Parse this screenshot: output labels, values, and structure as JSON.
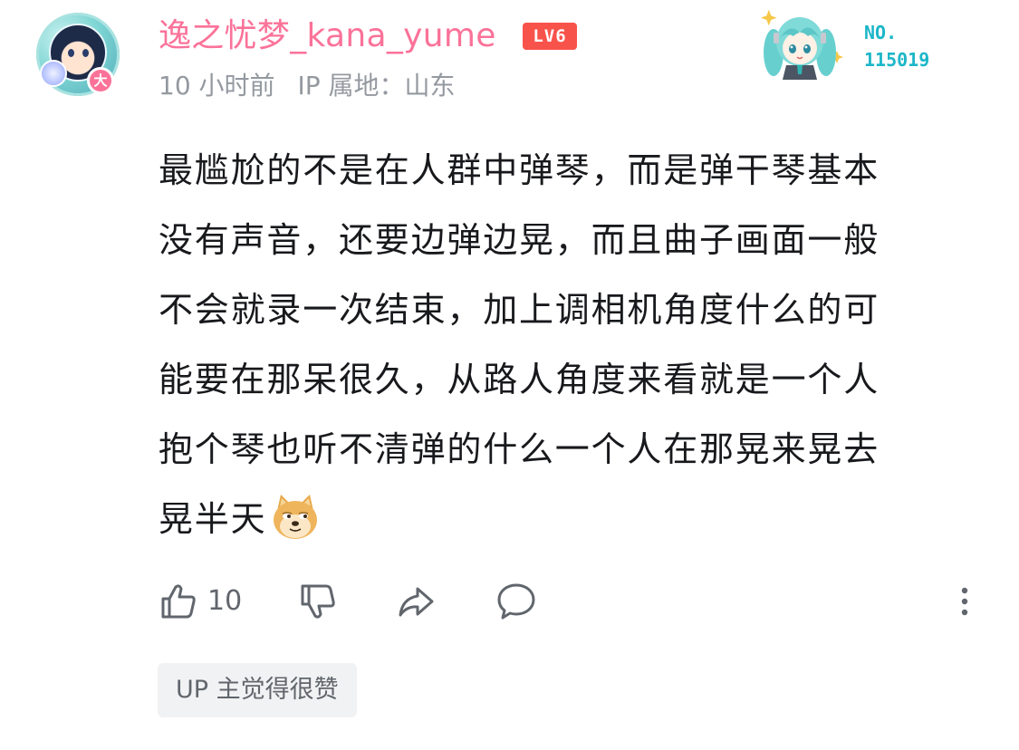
{
  "comment": {
    "username": "逸之忧梦_kana_yume",
    "level": "LV6",
    "avatar_badge": "大",
    "time": "10 小时前",
    "ip_location": "IP 属地：山东",
    "fan_badge": {
      "label": "NO.",
      "number": "115019"
    },
    "content_lines": [
      "最尴尬的不是在人群中弹琴，而是弹干琴基本",
      "没有声音，还要边弹边晃，而且曲子画面一般",
      "不会就录一次结束，加上调相机角度什么的可",
      "能要在那呆很久，从路人角度来看就是一个人",
      "抱个琴也听不清弹的什么一个人在那晃来晃去",
      "晃半天"
    ],
    "emoji": "doge",
    "like_count": "10",
    "up_tag": "UP 主觉得很赞"
  },
  "colors": {
    "username": "#fb7299",
    "level_badge": "#f8534b",
    "meta_text": "#9499a0",
    "body_text": "#18191c",
    "icon": "#61666d",
    "fan_number": "#1cb6c8",
    "tag_bg": "#f1f2f3"
  },
  "icons": {
    "like": "thumbs-up-icon",
    "dislike": "thumbs-down-icon",
    "share": "share-arrow-icon",
    "reply": "speech-bubble-icon",
    "more": "vertical-ellipsis-icon"
  }
}
